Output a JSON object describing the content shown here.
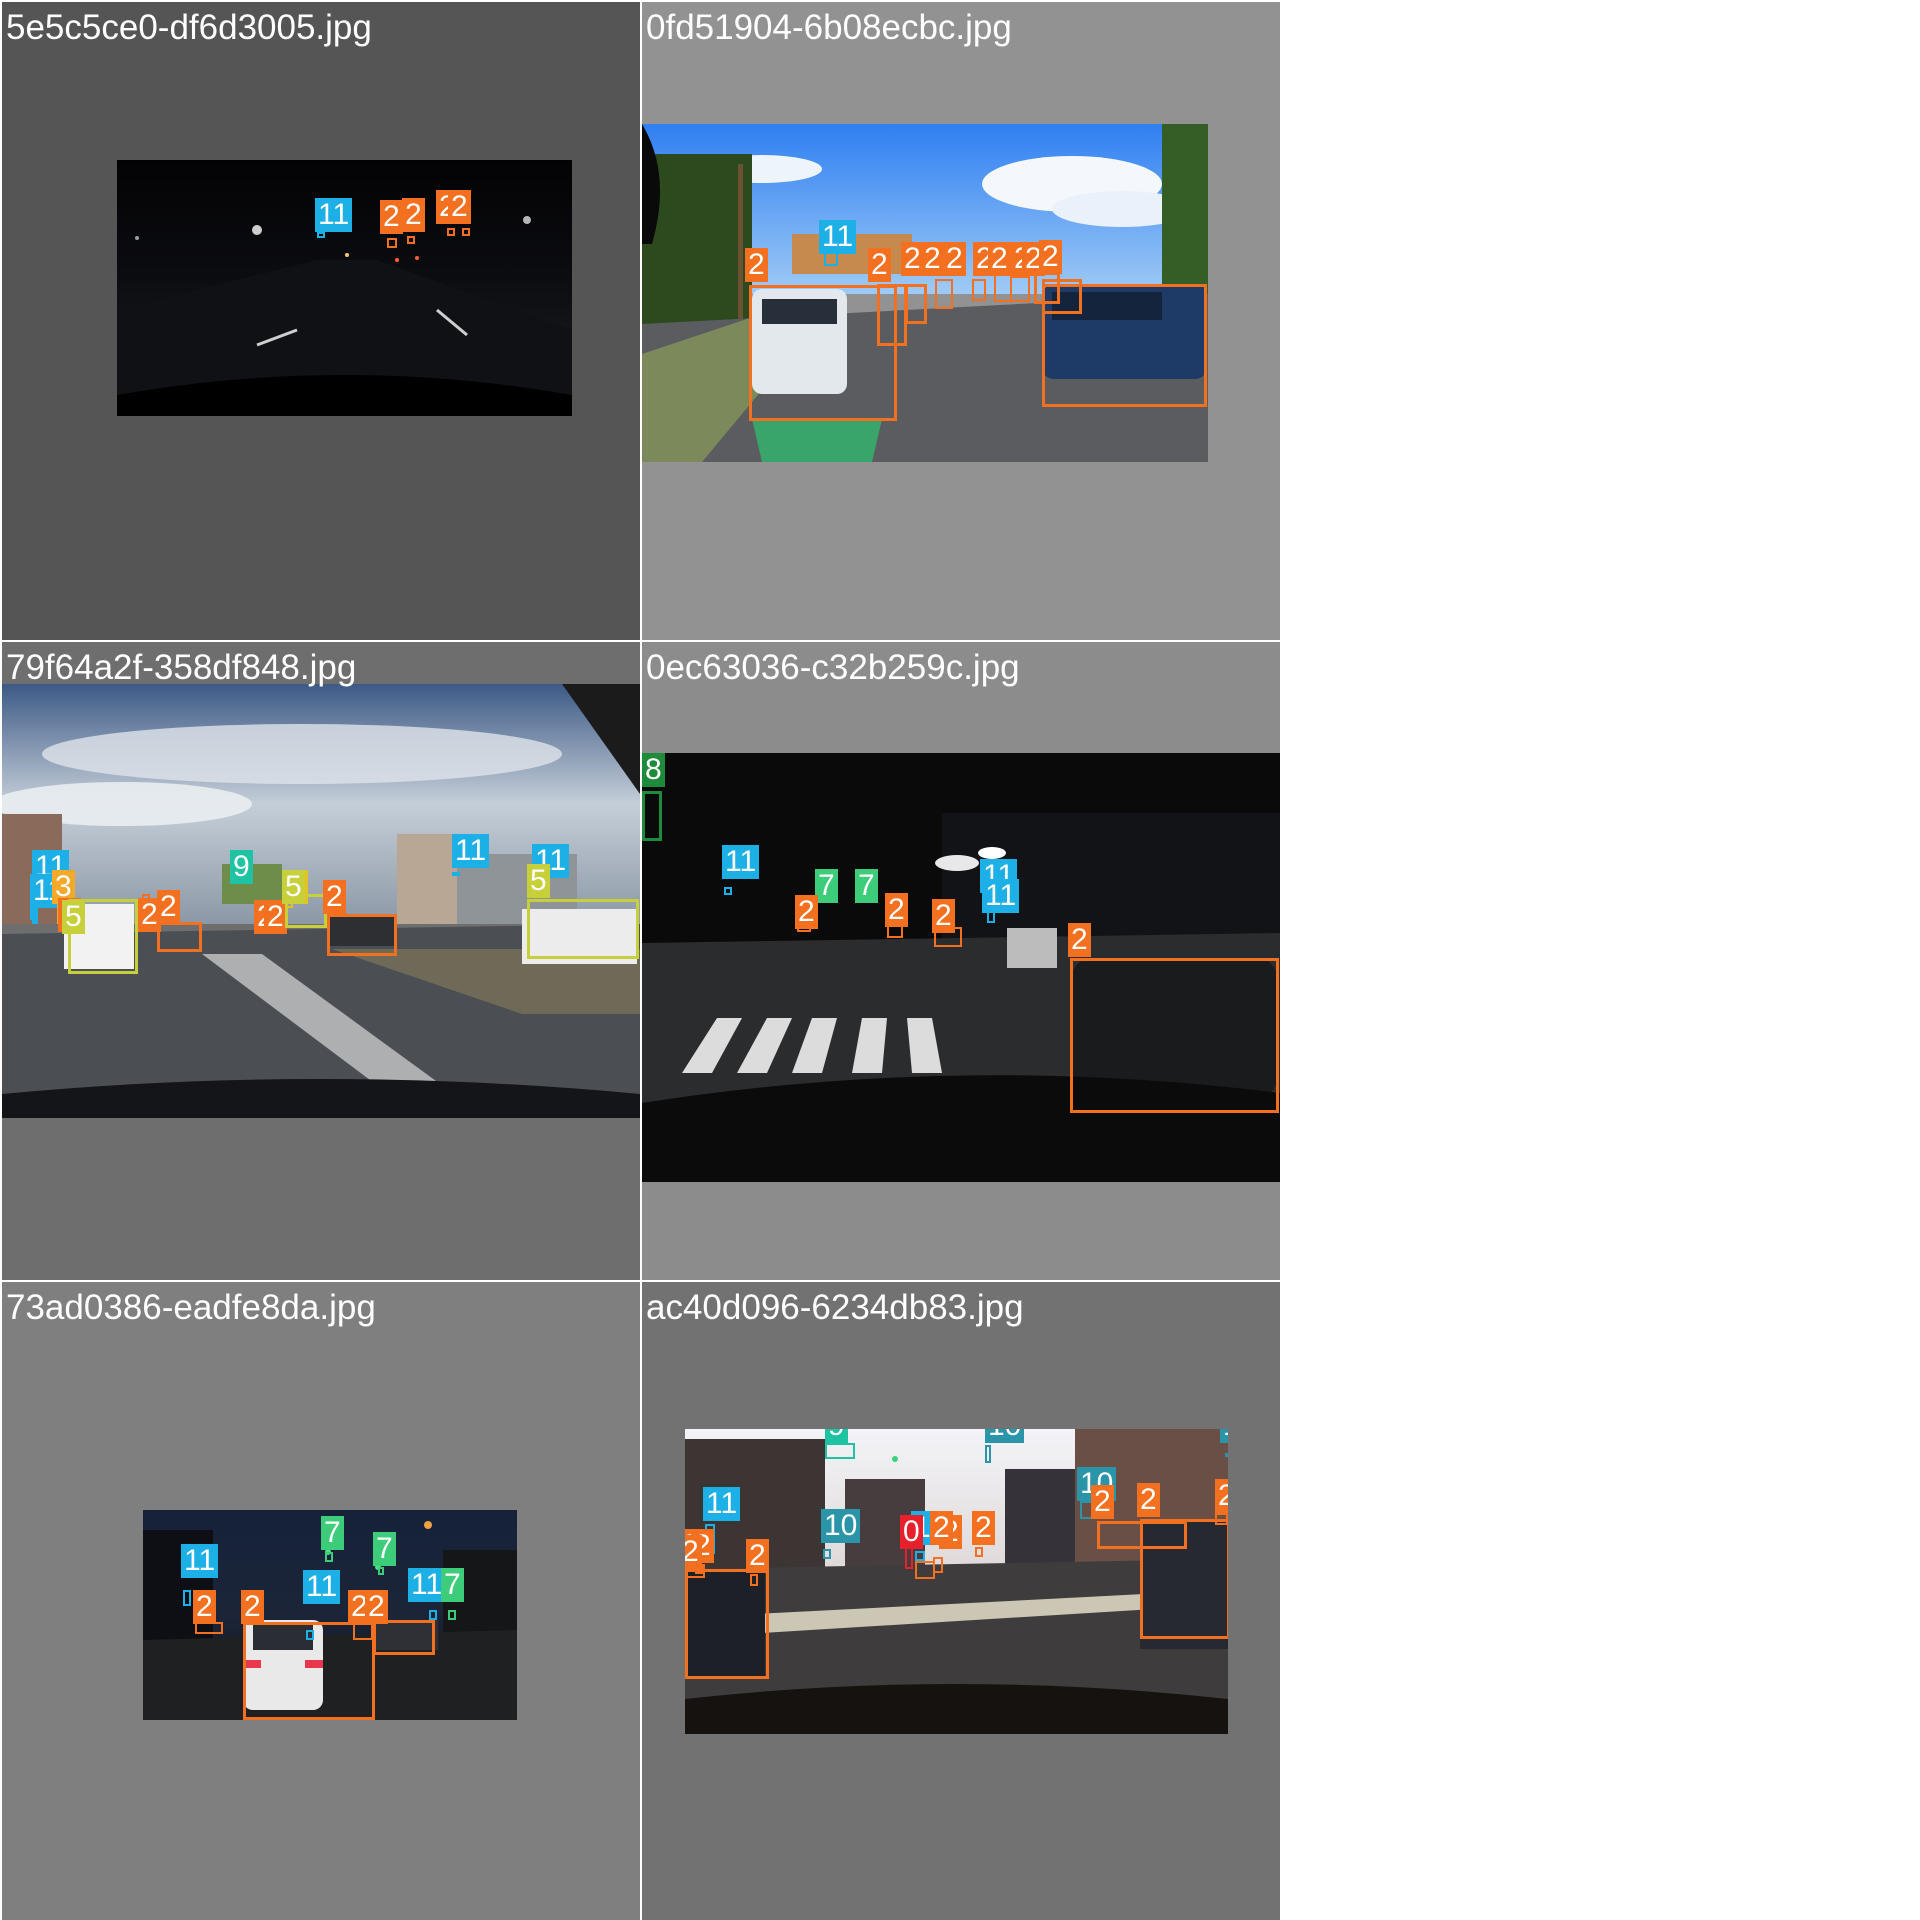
{
  "class_colors": {
    "0": "#e8202b",
    "2": "#f2701f",
    "3": "#f4a92b",
    "4": "#e6c21e",
    "5": "#c7cf3a",
    "7": "#3dcc7a",
    "8": "#1e8b3a",
    "9": "#1fc2a3",
    "10": "#2a95a8",
    "11": "#1db0e6"
  },
  "tiles": [
    {
      "title": "5e5c5ce0-df6d3005.jpg",
      "background": "#555555",
      "scene": "night-highway"
    },
    {
      "title": "0fd51904-6b08ecbc.jpg",
      "background": "#929292",
      "scene": "sunny-street"
    },
    {
      "title": "79f64a2f-358df848.jpg",
      "background": "#6e6e6e",
      "scene": "cloudy-avenue"
    },
    {
      "title": "0ec63036-c32b259c.jpg",
      "background": "#8c8c8c",
      "scene": "night-crosswalk"
    },
    {
      "title": "73ad0386-eadfe8da.jpg",
      "background": "#7f7f7f",
      "scene": "night-intersection"
    },
    {
      "title": "ac40d096-6234db83.jpg",
      "background": "#727272",
      "scene": "dusk-crosswalk"
    }
  ]
}
